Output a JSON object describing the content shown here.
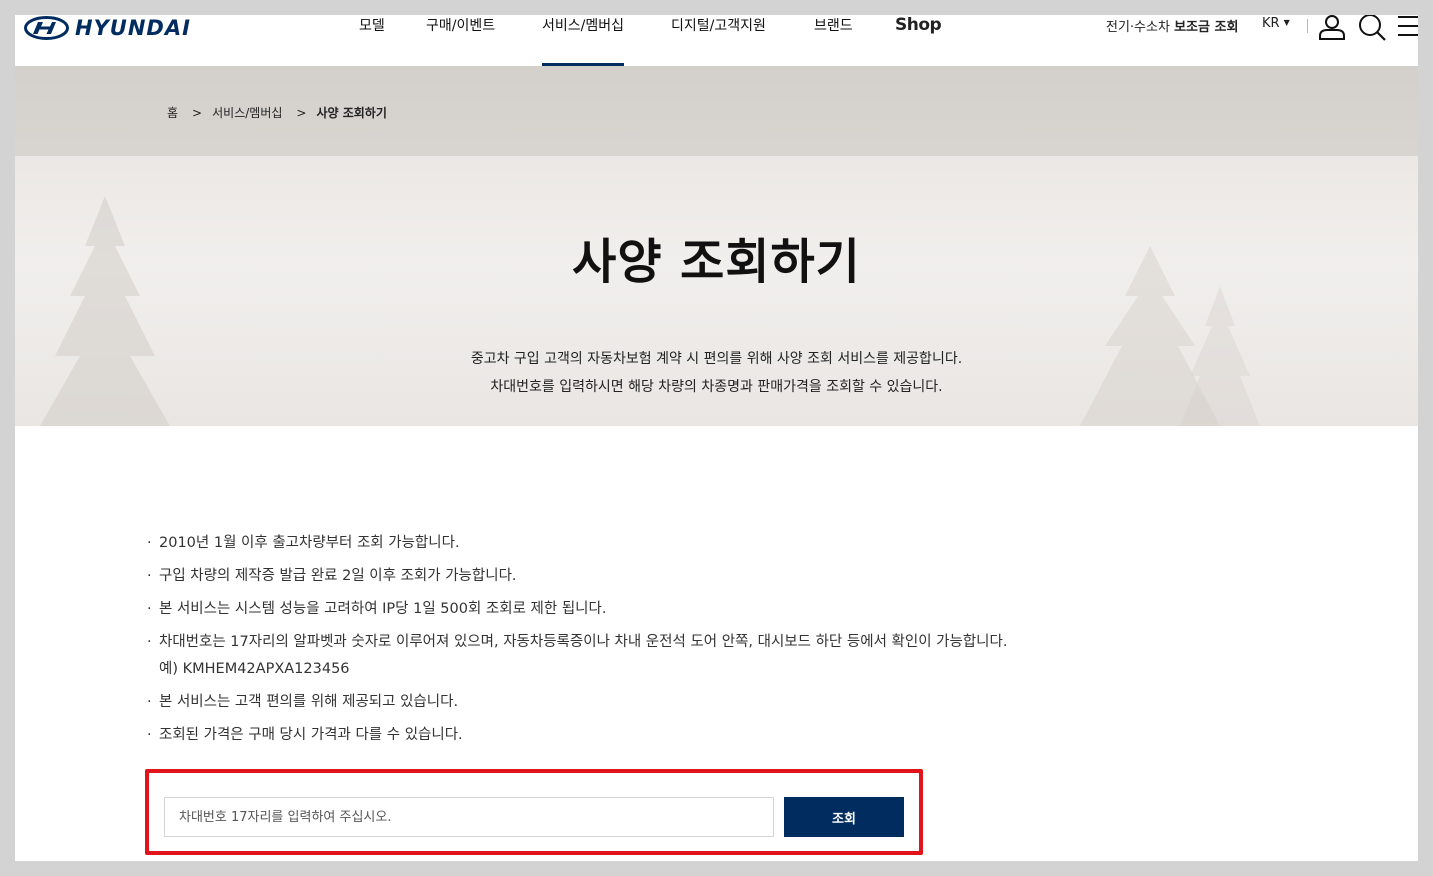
{
  "header": {
    "logo_text": "HYUNDAI",
    "nav": [
      {
        "label": "모델"
      },
      {
        "label": "구매/이벤트"
      },
      {
        "label": "서비스/멤버십"
      },
      {
        "label": "디지털/고객지원"
      },
      {
        "label": "브랜드"
      },
      {
        "label": "Shop"
      }
    ],
    "ev_subsidy_prefix": "전기·수소차 ",
    "ev_subsidy_bold": "보조금 조회",
    "language": "KR"
  },
  "breadcrumb": {
    "home": "홈",
    "level1": "서비스/멤버십",
    "current": "사양 조회하기"
  },
  "hero": {
    "title": "사양 조회하기",
    "desc_line1": "중고차 구입 고객의 자동차보험 계약 시 편의를 위해 사양 조회 서비스를 제공합니다.",
    "desc_line2": "차대번호를 입력하시면 해당 차량의 차종명과 판매가격을 조회할 수 있습니다."
  },
  "notes": [
    "2010년 1월 이후 출고차량부터 조회 가능합니다.",
    "구입 차량의 제작증 발급 완료 2일 이후 조회가 가능합니다.",
    "본 서비스는 시스템 성능을 고려하여 IP당 1일 500회 조회로 제한 됩니다.",
    "차대번호는 17자리의 알파벳과 숫자로 이루어져 있으며, 자동차등록증이나 차내 운전석 도어 안쪽, 대시보드 하단 등에서 확인이 가능합니다.",
    "본 서비스는 고객 편의를 위해 제공되고 있습니다.",
    "조회된 가격은 구매 당시 가격과 다를 수 있습니다."
  ],
  "notes_example": "예) KMHEM42APXA123456",
  "search": {
    "placeholder": "차대번호 17자리를 입력하여 주십시오.",
    "value": "",
    "button_label": "조회"
  },
  "colors": {
    "brand": "#002c5f",
    "highlight": "#e2141b"
  }
}
